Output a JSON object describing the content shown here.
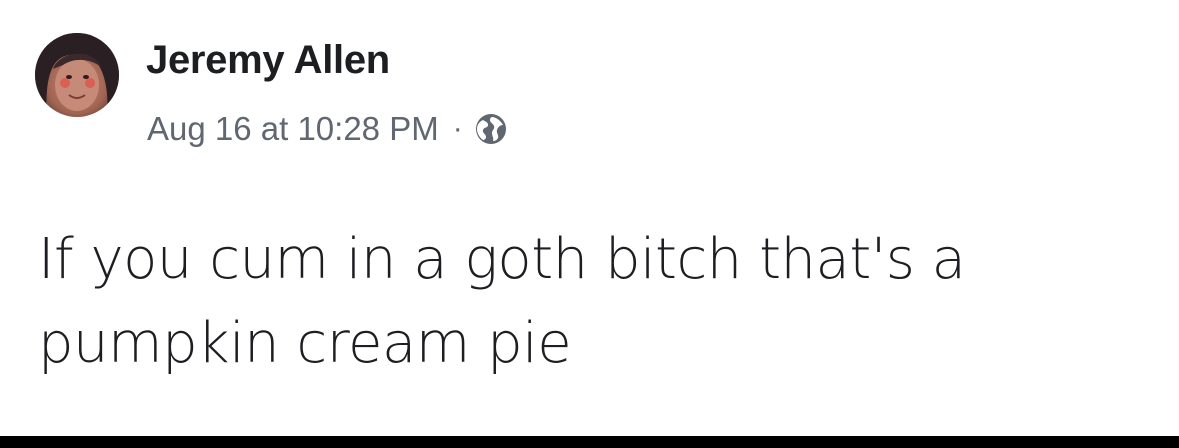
{
  "post": {
    "author_name": "Jeremy Allen",
    "timestamp": "Aug 16 at 10:28 PM",
    "separator": "·",
    "privacy_icon": "globe-icon",
    "text": "If you cum in a goth bitch that's a pumpkin cream pie"
  }
}
